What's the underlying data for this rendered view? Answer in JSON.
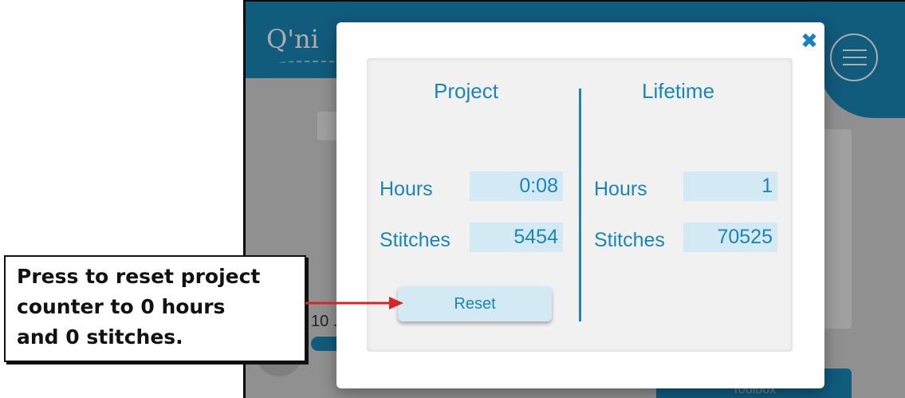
{
  "app": {
    "logo_text": "Q'ni",
    "progress_text": "10 .",
    "toolbox_label": "Toolbox"
  },
  "dialog": {
    "close_icon": "✖",
    "project": {
      "title": "Project",
      "hours_label": "Hours",
      "hours_value": "0:08",
      "stitches_label": "Stitches",
      "stitches_value": "5454"
    },
    "lifetime": {
      "title": "Lifetime",
      "hours_label": "Hours",
      "hours_value": "1",
      "stitches_label": "Stitches",
      "stitches_value": "70525"
    },
    "reset_label": "Reset"
  },
  "callout": {
    "text": "Press to reset project\ncounter to 0 hours\nand 0 stitches."
  },
  "colors": {
    "accent": "#1a86b8",
    "field_bg": "#d3e9f3",
    "arrow": "#d6262b"
  },
  "icons": {
    "menu": "hamburger-menu-icon",
    "close": "close-x-icon"
  }
}
